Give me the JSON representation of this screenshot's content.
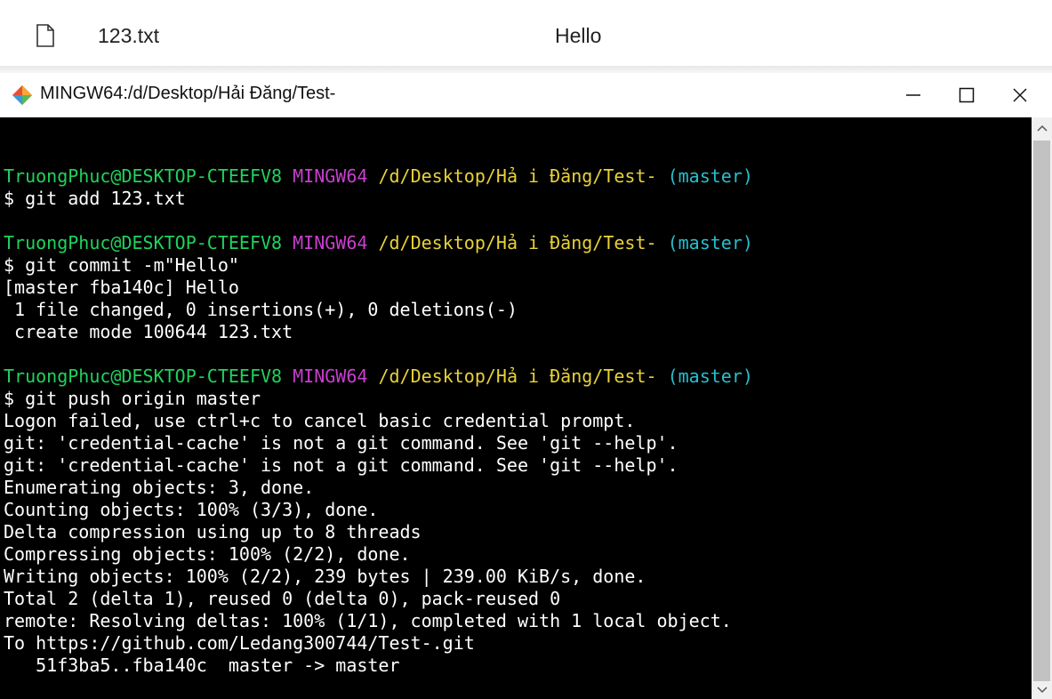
{
  "file_row": {
    "file_name": "123.txt",
    "commit_message": "Hello"
  },
  "window": {
    "title": "MINGW64:/d/Desktop/Hải Đăng/Test-"
  },
  "colors": {
    "user": "#1fd35d",
    "env": "#c93ed0",
    "path": "#e8d238",
    "branch": "#27bfcf",
    "text": "#ffffff",
    "background": "#000000"
  },
  "terminal": {
    "lines": [
      {
        "type": "blank",
        "text": ""
      },
      {
        "type": "prompt",
        "user": "TruongPhuc@DESKTOP-CTEEFV8",
        "env": "MINGW64",
        "path": "/d/Desktop/Hả i Đăng/Test-",
        "branch": "(master)"
      },
      {
        "type": "text",
        "text": "$ git add 123.txt"
      },
      {
        "type": "blank",
        "text": ""
      },
      {
        "type": "prompt",
        "user": "TruongPhuc@DESKTOP-CTEEFV8",
        "env": "MINGW64",
        "path": "/d/Desktop/Hả i Đăng/Test-",
        "branch": "(master)"
      },
      {
        "type": "text",
        "text": "$ git commit -m\"Hello\""
      },
      {
        "type": "text",
        "text": "[master fba140c] Hello"
      },
      {
        "type": "text",
        "text": " 1 file changed, 0 insertions(+), 0 deletions(-)"
      },
      {
        "type": "text",
        "text": " create mode 100644 123.txt"
      },
      {
        "type": "blank",
        "text": ""
      },
      {
        "type": "prompt",
        "user": "TruongPhuc@DESKTOP-CTEEFV8",
        "env": "MINGW64",
        "path": "/d/Desktop/Hả i Đăng/Test-",
        "branch": "(master)"
      },
      {
        "type": "text",
        "text": "$ git push origin master"
      },
      {
        "type": "text",
        "text": "Logon failed, use ctrl+c to cancel basic credential prompt."
      },
      {
        "type": "text",
        "text": "git: 'credential-cache' is not a git command. See 'git --help'."
      },
      {
        "type": "text",
        "text": "git: 'credential-cache' is not a git command. See 'git --help'."
      },
      {
        "type": "text",
        "text": "Enumerating objects: 3, done."
      },
      {
        "type": "text",
        "text": "Counting objects: 100% (3/3), done."
      },
      {
        "type": "text",
        "text": "Delta compression using up to 8 threads"
      },
      {
        "type": "text",
        "text": "Compressing objects: 100% (2/2), done."
      },
      {
        "type": "text",
        "text": "Writing objects: 100% (2/2), 239 bytes | 239.00 KiB/s, done."
      },
      {
        "type": "text",
        "text": "Total 2 (delta 1), reused 0 (delta 0), pack-reused 0"
      },
      {
        "type": "text",
        "text": "remote: Resolving deltas: 100% (1/1), completed with 1 local object."
      },
      {
        "type": "text",
        "text": "To https://github.com/Ledang300744/Test-.git"
      },
      {
        "type": "text",
        "text": "   51f3ba5..fba140c  master -> master"
      }
    ]
  }
}
